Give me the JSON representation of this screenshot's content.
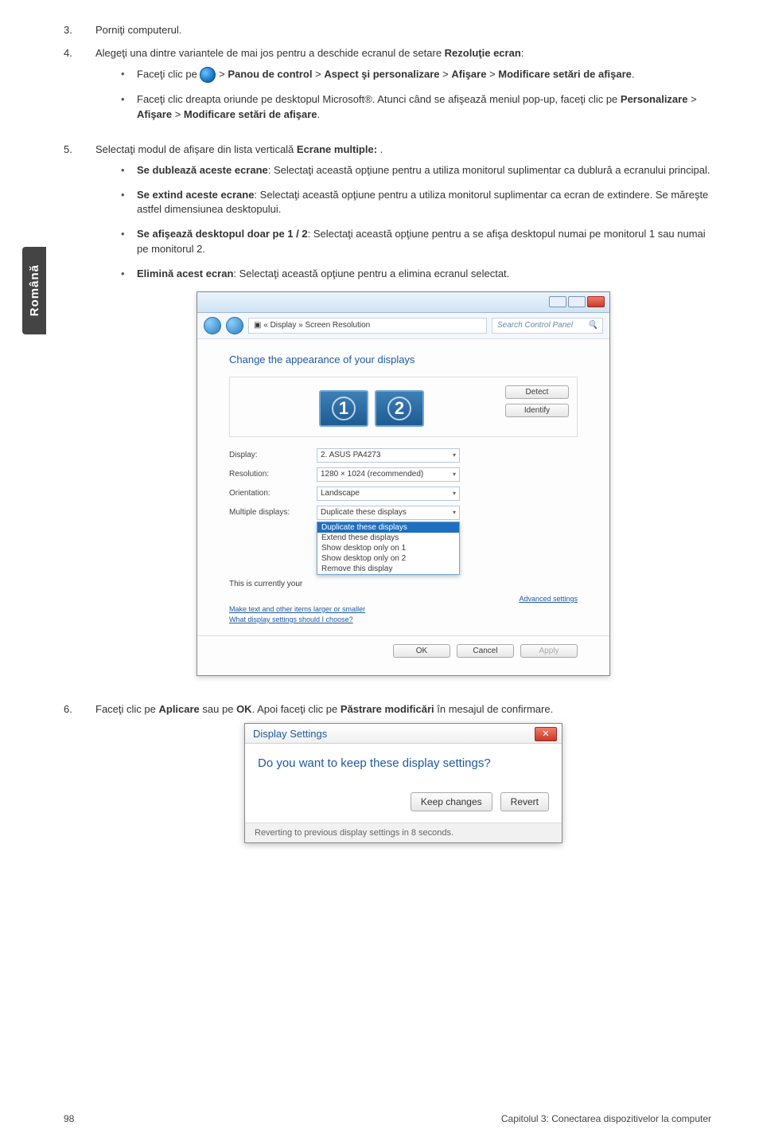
{
  "sidebar_tab": "Română",
  "steps": {
    "s3": {
      "num": "3.",
      "text": "Porniţi computerul."
    },
    "s4": {
      "num": "4.",
      "text_a": "Alegeţi una dintre variantele de mai jos pentru a deschide ecranul de setare ",
      "bold_a": "Rezoluţie ecran",
      "text_b": ":",
      "bullets": {
        "b1": {
          "a": "Faceţi clic pe ",
          "gt1": " > ",
          "s1": "Panou de control",
          "gt2": " > ",
          "s2": "Aspect şi personalizare",
          "gt3": " > ",
          "s3": "Afişare",
          "gt4": " > ",
          "s4": "Modificare setări de afişare",
          "dot": "."
        },
        "b2": {
          "a": "Faceţi clic dreapta oriunde pe desktopul Microsoft®. Atunci când se afişează meniul pop-up, faceţi clic pe ",
          "s1": "Personalizare",
          "gt1": " > ",
          "s2": "Afişare",
          "gt2": " > ",
          "s3": "Modificare setări de afişare",
          "dot": "."
        }
      }
    },
    "s5": {
      "num": "5.",
      "text_a": "Selectaţi modul de afişare din lista verticală ",
      "bold_a": "Ecrane multiple:",
      "text_b": " .",
      "bullets": {
        "b1": {
          "s": "Se dublează aceste ecrane",
          "t": ": Selectaţi această opţiune pentru a utiliza monitorul suplimentar ca dublură a ecranului principal."
        },
        "b2": {
          "s": "Se extind aceste ecrane",
          "t": ": Selectaţi această opţiune pentru a utiliza monitorul suplimentar ca ecran de extindere. Se măreşte astfel dimensiunea desktopului."
        },
        "b3": {
          "s": "Se afişează desktopul doar pe 1 / 2",
          "t": ": Selectaţi această opţiune pentru a se afişa desktopul numai pe monitorul 1 sau numai pe monitorul 2."
        },
        "b4": {
          "s": "Elimină acest ecran",
          "t": ": Selectaţi această opţiune pentru a elimina ecranul selectat."
        }
      }
    },
    "s6": {
      "num": "6.",
      "a": "Faceţi clic pe ",
      "s1": "Aplicare",
      "b": " sau pe ",
      "s2": "OK",
      "c": ". Apoi faceţi clic pe ",
      "s3": "Păstrare modificări",
      "d": " în mesajul de confirmare."
    }
  },
  "win": {
    "crumb": "▣ « Display » Screen Resolution",
    "search_ph": "Search Control Panel",
    "heading": "Change the appearance of your displays",
    "mon1": "1",
    "mon2": "2",
    "btn_detect": "Detect",
    "btn_identify": "Identify",
    "rows": {
      "display": {
        "lbl": "Display:",
        "val": "2. ASUS PA4273"
      },
      "resolution": {
        "lbl": "Resolution:",
        "val": "1280 × 1024 (recommended)"
      },
      "orientation": {
        "lbl": "Orientation:",
        "val": "Landscape"
      },
      "multi": {
        "lbl": "Multiple displays:",
        "val": "Duplicate these displays"
      }
    },
    "dd": {
      "o1": "Duplicate these displays",
      "o2": "Extend these displays",
      "o3": "Show desktop only on 1",
      "o4": "Show desktop only on 2",
      "o5": "Remove this display"
    },
    "note_a": "This is currently your ",
    "link1": "Make text and other items larger or smaller",
    "link2": "What display settings should I choose?",
    "adv": "Advanced settings",
    "ok": "OK",
    "cancel": "Cancel",
    "apply": "Apply"
  },
  "dlg": {
    "title": "Display Settings",
    "q": "Do you want to keep these display settings?",
    "keep": "Keep changes",
    "revert": "Revert",
    "foot": "Reverting to previous display settings in 8 seconds."
  },
  "footer": {
    "page": "98",
    "chapter": "Capitolul 3: Conectarea dispozitivelor la computer"
  }
}
